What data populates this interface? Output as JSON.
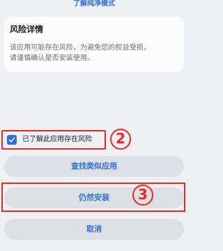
{
  "top_link": "了解纯净模式",
  "risk": {
    "title": "风险详情",
    "description_line1": "该应用可能存在风险，为避免您的权益受损，",
    "description_line2": "请谨慎确认是否安装使用。"
  },
  "checkbox": {
    "label": "已了解此应用存在风险",
    "checked": true,
    "step_number": "2"
  },
  "buttons": {
    "find_similar": "查找类似应用",
    "install_anyway": "仍然安装",
    "cancel": "取消"
  },
  "install_step_number": "3",
  "colors": {
    "accent": "#2f6fe0",
    "annotation_red": "#e62a22",
    "background": "#eef0f3",
    "card": "#fbfbfc",
    "button_bg": "#dde0e4"
  }
}
